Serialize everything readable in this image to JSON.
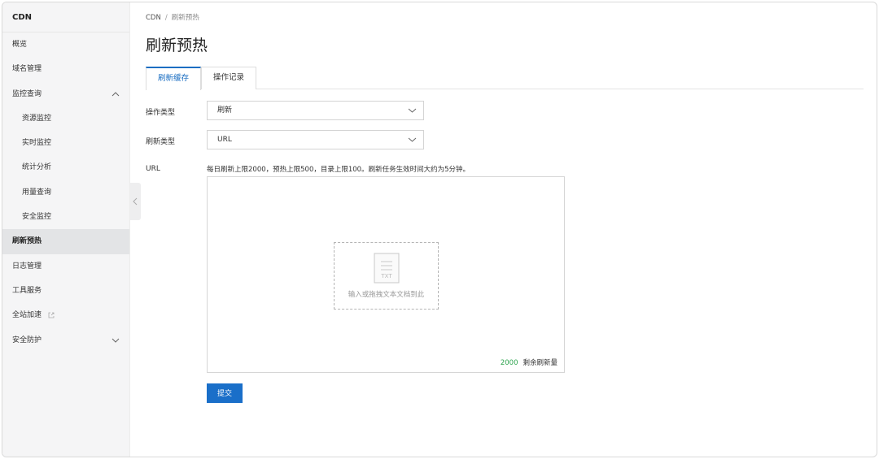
{
  "sidebar": {
    "title": "CDN",
    "items": [
      {
        "label": "概览"
      },
      {
        "label": "域名管理"
      },
      {
        "label": "监控查询"
      },
      {
        "label": "资源监控"
      },
      {
        "label": "实时监控"
      },
      {
        "label": "统计分析"
      },
      {
        "label": "用量查询"
      },
      {
        "label": "安全监控"
      },
      {
        "label": "刷新预热"
      },
      {
        "label": "日志管理"
      },
      {
        "label": "工具服务"
      },
      {
        "label": "全站加速"
      },
      {
        "label": "安全防护"
      }
    ]
  },
  "breadcrumb": {
    "root": "CDN",
    "separator": "/",
    "current": "刷新预热"
  },
  "page": {
    "title": "刷新预热"
  },
  "tabs": [
    {
      "label": "刷新缓存"
    },
    {
      "label": "操作记录"
    }
  ],
  "form": {
    "op_type_label": "操作类型",
    "op_type_value": "刷新",
    "refresh_type_label": "刷新类型",
    "refresh_type_value": "URL",
    "url_label": "URL",
    "hint": "每日刷新上限2000，预热上限500，目录上限100。刷新任务生效时间大约为5分钟。",
    "drop_icon_text": "TXT",
    "drop_label": "输入或拖拽文本文档到此",
    "remaining_count": "2000",
    "remaining_label": "剩余刷新量",
    "submit_label": "提交"
  },
  "colors": {
    "accent": "#1a6fc9",
    "count_green": "#2ea44f",
    "sidebar_bg": "#f5f5f6",
    "sidebar_active_bg": "#e3e4e6"
  }
}
